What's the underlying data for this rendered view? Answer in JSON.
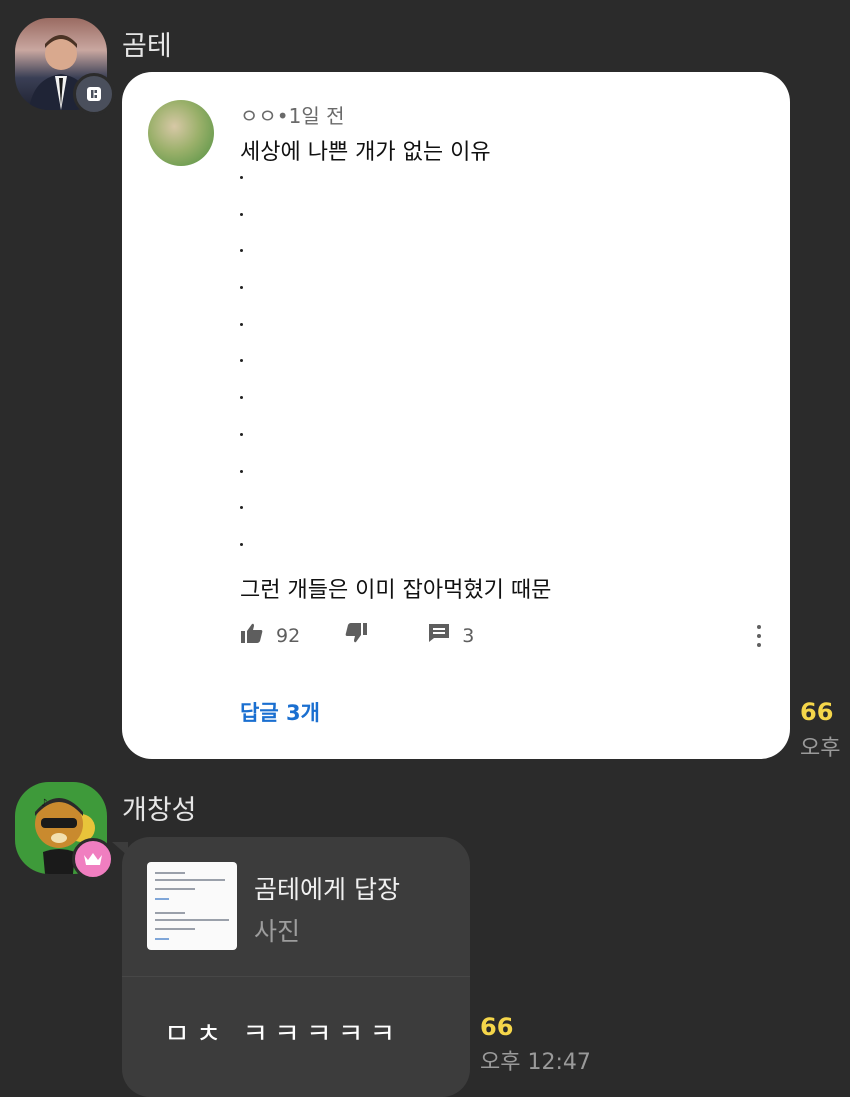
{
  "messages": [
    {
      "sender": "곰테",
      "avatar_icon": "person-photo",
      "badge_icon": "chat-badge-icon",
      "image_card": {
        "channel_meta": "ㅇㅇ•1일 전",
        "title": "세상에 나쁜 개가 없는 이유",
        "dot_lines": [
          ".",
          ".",
          ".",
          ".",
          ".",
          ".",
          ".",
          ".",
          ".",
          ".",
          "."
        ],
        "punchline": "그런 개들은 이미 잡아먹혔기 때문",
        "likes": "92",
        "replies_count": "3",
        "replies_link": "답글 3개"
      },
      "read_count": "66",
      "time": "오후"
    },
    {
      "sender": "개창성",
      "avatar_icon": "character-avatar",
      "badge_icon": "crown-icon",
      "reply": {
        "to": "곰테에게 답장",
        "kind": "사진"
      },
      "text": "ㅁㅊ ㅋㅋㅋㅋㅋ",
      "read_count": "66",
      "time": "오후 12:47"
    }
  ],
  "colors": {
    "background": "#2b2b2b",
    "read_count": "#f5d64a",
    "link": "#1a6fd0",
    "bubble": "#3c3c3c"
  }
}
